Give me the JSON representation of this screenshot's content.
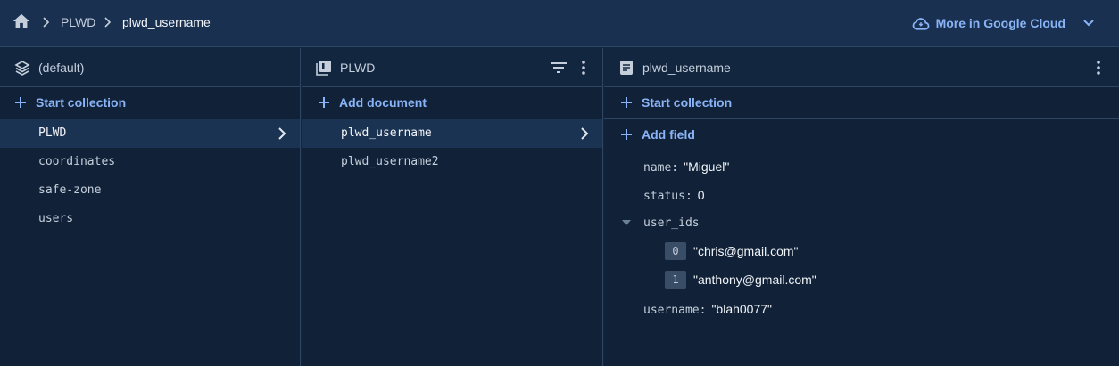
{
  "breadcrumb": {
    "items": [
      "PLWD",
      "plwd_username"
    ]
  },
  "header": {
    "cloud_label": "More in Google Cloud"
  },
  "columns": {
    "root": {
      "title": "(default)",
      "action": "Start collection",
      "items": [
        "PLWD",
        "coordinates",
        "safe-zone",
        "users"
      ],
      "selected": "PLWD"
    },
    "collection": {
      "title": "PLWD",
      "action": "Add document",
      "items": [
        "plwd_username",
        "plwd_username2"
      ],
      "selected": "plwd_username"
    },
    "document": {
      "title": "plwd_username",
      "action_collection": "Start collection",
      "action_field": "Add field",
      "fields": {
        "name": {
          "key": "name:",
          "value": "\"Miguel\""
        },
        "status": {
          "key": "status:",
          "value": "0"
        },
        "user_ids": {
          "key": "user_ids",
          "items": [
            {
              "index": "0",
              "value": "\"chris@gmail.com\""
            },
            {
              "index": "1",
              "value": "\"anthony@gmail.com\""
            }
          ]
        },
        "username": {
          "key": "username:",
          "value": "\"blah0077\""
        }
      }
    }
  },
  "colors": {
    "accent": "#8ab4f8",
    "background": "#112238",
    "header": "#1a3050"
  }
}
